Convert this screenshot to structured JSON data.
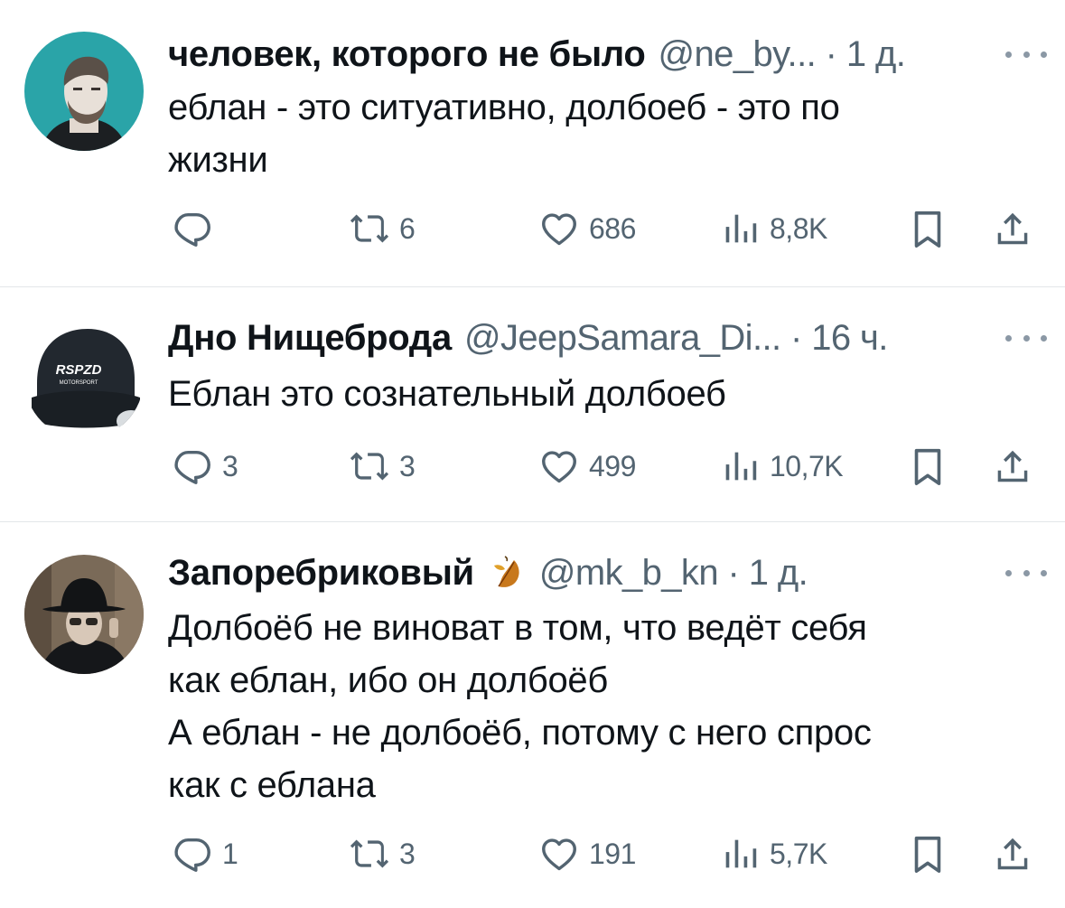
{
  "tweets": [
    {
      "name": "человек, которого не было",
      "handle": "@ne_by... · 1 д.",
      "text": "еблан - это ситуативно, долбоеб - это по\nжизни",
      "replies": "",
      "retweets": "6",
      "likes": "686",
      "views": "8,8K"
    },
    {
      "name": "Дно Нищеброда",
      "handle": "@JeepSamara_Di... · 16 ч.",
      "text": "Еблан это сознательный долбоеб",
      "avatar_text_1": "RSPZD",
      "avatar_text_2": "MOTORSPORT",
      "replies": "3",
      "retweets": "3",
      "likes": "499",
      "views": "10,7K"
    },
    {
      "name": "Запоребриковый",
      "handle": "@mk_b_kn · 1 д.",
      "text": "Долбоёб не виноват в том, что ведёт себя\nкак еблан, ибо он долбоёб\nА еблан - не долбоёб, потому с него спрос\nкак с еблана",
      "replies": "1",
      "retweets": "3",
      "likes": "191",
      "views": "5,7K"
    }
  ],
  "icons": {
    "reply": "reply-icon",
    "retweet": "retweet-icon",
    "like": "heart-icon",
    "views": "views-icon",
    "bookmark": "bookmark-icon",
    "share": "share-icon",
    "more": "more-icon",
    "emoji": "autumn-leaf-icon"
  },
  "colors": {
    "text": "#0f1419",
    "secondary": "#536471",
    "divider": "#e3e6e9",
    "avatar1_bg": "#2aa4a8"
  }
}
